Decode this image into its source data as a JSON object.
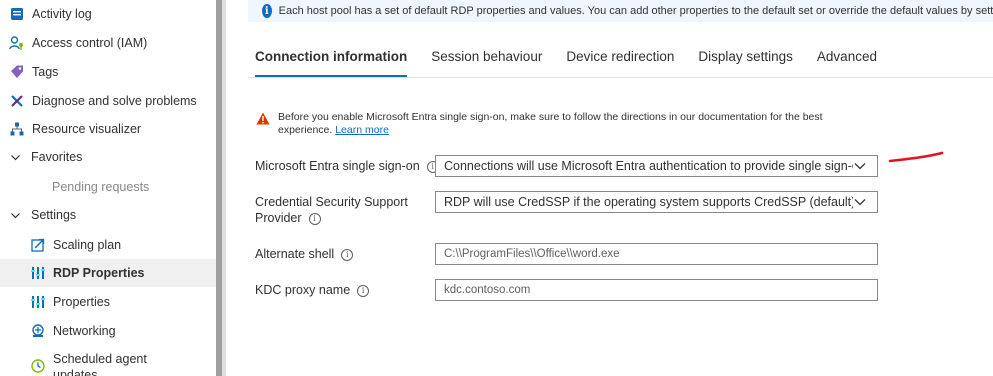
{
  "sidebar": {
    "items": [
      {
        "label": "Activity log",
        "icon": "activity-log-icon"
      },
      {
        "label": "Access control (IAM)",
        "icon": "access-control-icon"
      },
      {
        "label": "Tags",
        "icon": "tag-icon"
      },
      {
        "label": "Diagnose and solve problems",
        "icon": "wrench-icon"
      },
      {
        "label": "Resource visualizer",
        "icon": "resource-visualizer-icon"
      },
      {
        "label": "Favorites",
        "icon": "chevron-down-icon"
      },
      {
        "label": "Pending requests"
      },
      {
        "label": "Settings",
        "icon": "chevron-down-icon"
      },
      {
        "label": "Scaling plan",
        "icon": "scaling-plan-icon"
      },
      {
        "label": "RDP Properties",
        "icon": "rdp-properties-icon",
        "selected": true
      },
      {
        "label": "Properties",
        "icon": "properties-icon"
      },
      {
        "label": "Networking",
        "icon": "networking-icon"
      },
      {
        "label": "Scheduled agent",
        "label2": "updates",
        "icon": "clock-icon"
      }
    ]
  },
  "info_banner": {
    "text": "Each host pool has a set of default RDP properties and values. You can add other properties to the default set or override the default values by setting"
  },
  "tabs": [
    {
      "label": "Connection information",
      "active": true
    },
    {
      "label": "Session behaviour"
    },
    {
      "label": "Device redirection"
    },
    {
      "label": "Display settings"
    },
    {
      "label": "Advanced"
    }
  ],
  "warning": {
    "text": "Before you enable Microsoft Entra single sign-on, make sure to follow the directions in our documentation for the best experience.",
    "link": "Learn more"
  },
  "form": {
    "sso": {
      "label": "Microsoft Entra single sign-on",
      "value": "Connections will use Microsoft Entra authentication to provide single sign-on"
    },
    "credssp": {
      "label_line1": "Credential Security Support",
      "label_line2": "Provider",
      "value": "RDP will use CredSSP if the operating system supports CredSSP (default)"
    },
    "shell": {
      "label": "Alternate shell",
      "placeholder": "C:\\\\ProgramFiles\\\\Office\\\\word.exe"
    },
    "kdc": {
      "label": "KDC proxy name",
      "placeholder": "kdc.contoso.com"
    }
  },
  "colors": {
    "accent": "#0f6cbd",
    "warning": "#d83b01",
    "annotation": "#e81123"
  }
}
